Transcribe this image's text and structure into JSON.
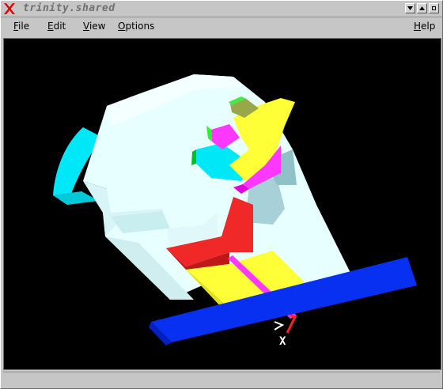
{
  "window": {
    "title": "trinity.shared",
    "icon": "x-logo-icon",
    "buttons": [
      "minimize-icon",
      "maximize-icon",
      "close-icon"
    ]
  },
  "menubar": {
    "items": [
      {
        "label": "File",
        "mnemonic": "F"
      },
      {
        "label": "Edit",
        "mnemonic": "E"
      },
      {
        "label": "View",
        "mnemonic": "V"
      },
      {
        "label": "Options",
        "mnemonic": "O"
      }
    ],
    "help": {
      "label": "Help",
      "mnemonic": "H"
    }
  },
  "viewport": {
    "background": "#000000",
    "scene": "3d-model",
    "colors": {
      "body": "#e8ffff",
      "body_shade": "#c8eef0",
      "cyan": "#00e8f8",
      "yellow": "#ffff38",
      "red": "#f02828",
      "magenta": "#ff38ff",
      "blue": "#0830f0",
      "green": "#48e848",
      "olive": "#98a848",
      "gray_blue": "#a8d0d8"
    },
    "axes": {
      "x_label": "X"
    }
  }
}
